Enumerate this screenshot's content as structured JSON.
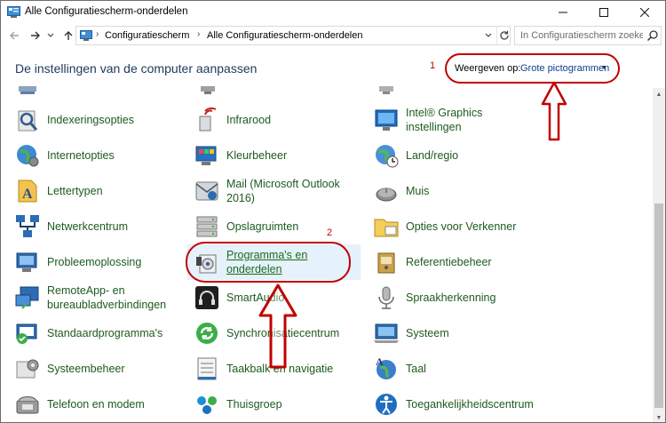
{
  "window": {
    "title": "Alle Configuratiescherm-onderdelen",
    "controls": {
      "minimize": "—",
      "maximize": "☐",
      "close": "✕"
    }
  },
  "address": {
    "crumbs": [
      "Configuratiescherm",
      "Alle Configuratiescherm-onderdelen"
    ],
    "separator": "›",
    "search_placeholder": "In Configuratiescherm zoeken"
  },
  "header": {
    "title": "De instellingen van de computer aanpassen",
    "view_label": "Weergeven op:",
    "view_value": "Grote pictogrammen",
    "annotation_number": "1"
  },
  "annotation": {
    "highlight_number": "2",
    "color": "#c00000"
  },
  "items": [
    {
      "label": "Indexeringsopties",
      "icon": "indexing-icon"
    },
    {
      "label": "Infrarood",
      "icon": "infrared-icon"
    },
    {
      "label": "Intel® Graphics instellingen",
      "icon": "intel-graphics-icon"
    },
    {
      "label": "Internetopties",
      "icon": "internet-options-icon"
    },
    {
      "label": "Kleurbeheer",
      "icon": "color-management-icon"
    },
    {
      "label": "Land/regio",
      "icon": "region-icon"
    },
    {
      "label": "Lettertypen",
      "icon": "fonts-icon"
    },
    {
      "label": "Mail (Microsoft Outlook 2016)",
      "icon": "mail-icon"
    },
    {
      "label": "Muis",
      "icon": "mouse-icon"
    },
    {
      "label": "Netwerkcentrum",
      "icon": "network-icon"
    },
    {
      "label": "Opslagruimten",
      "icon": "storage-spaces-icon"
    },
    {
      "label": "Opties voor Verkenner",
      "icon": "explorer-options-icon"
    },
    {
      "label": "Probleemoplossing",
      "icon": "troubleshooting-icon"
    },
    {
      "label": "Programma's en onderdelen",
      "icon": "programs-features-icon"
    },
    {
      "label": "Referentiebeheer",
      "icon": "credential-manager-icon"
    },
    {
      "label": "RemoteApp- en bureaubladverbindingen",
      "icon": "remoteapp-icon"
    },
    {
      "label": "SmartAudio",
      "icon": "smartaudio-icon"
    },
    {
      "label": "Spraakherkenning",
      "icon": "speech-icon"
    },
    {
      "label": "Standaardprogramma's",
      "icon": "default-programs-icon"
    },
    {
      "label": "Synchronisatiecentrum",
      "icon": "sync-center-icon"
    },
    {
      "label": "Systeem",
      "icon": "system-icon"
    },
    {
      "label": "Systeembeheer",
      "icon": "admin-tools-icon"
    },
    {
      "label": "Taakbalk en navigatie",
      "icon": "taskbar-icon"
    },
    {
      "label": "Taal",
      "icon": "language-icon"
    },
    {
      "label": "Telefoon en modem",
      "icon": "phone-modem-icon"
    },
    {
      "label": "Thuisgroep",
      "icon": "homegroup-icon"
    },
    {
      "label": "Toegankelijkheidscentrum",
      "icon": "ease-of-access-icon"
    }
  ]
}
